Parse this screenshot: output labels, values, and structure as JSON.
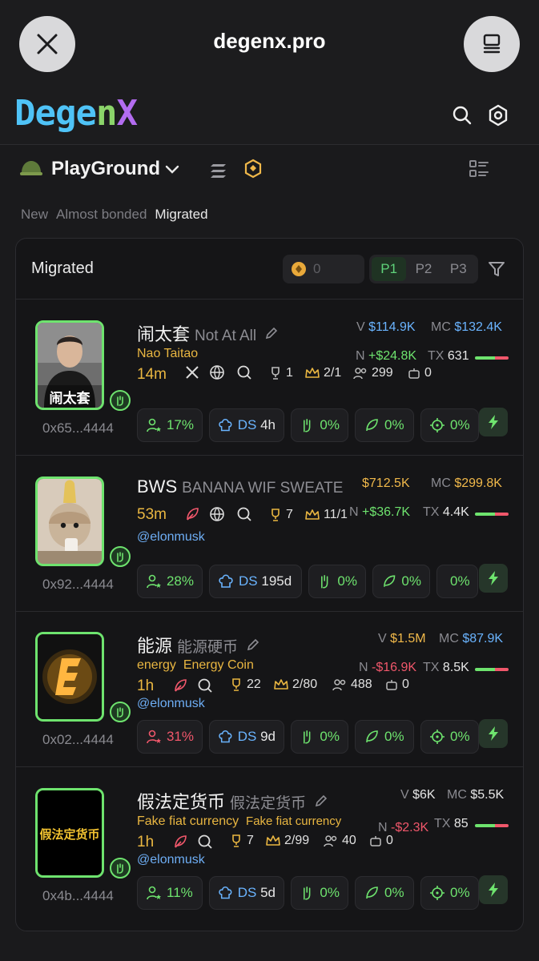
{
  "browser": {
    "title": "degenx.pro"
  },
  "app": {
    "logo": {
      "part1": "Dege",
      "part2": "n",
      "part3": "X"
    },
    "section_title": "PlayGround",
    "tabs": [
      "New",
      "Almost bonded",
      "Migrated"
    ],
    "active_tab": "Migrated"
  },
  "panel": {
    "title": "Migrated",
    "coin_count": "0",
    "page_tabs": [
      "P1",
      "P2",
      "P3"
    ],
    "active_page": "P1"
  },
  "tokens": [
    {
      "symbol": "闹太套",
      "name": "Not At All",
      "sub1": "Nao Taitao",
      "sub2": "",
      "age": "14m",
      "trophy": "1",
      "crown": "2/1",
      "holders": "299",
      "bots": "0",
      "handle": "",
      "address": "0x65...4444",
      "v": "$114.9K",
      "mc": "$132.4K",
      "n": "+$24.8K",
      "tx": "631",
      "chips": {
        "holders_pct": "17%",
        "ds": "4h",
        "c3": "0%",
        "c4": "0%",
        "c5": "0%"
      }
    },
    {
      "symbol": "BWS",
      "name": "BANANA WIF SWEATE",
      "sub1": "",
      "sub2": "",
      "age": "53m",
      "trophy": "7",
      "crown": "11/1",
      "holders": "",
      "bots": "",
      "handle": "@elonmusk",
      "address": "0x92...4444",
      "v": "$712.5K",
      "mc": "$299.8K",
      "n": "+$36.7K",
      "tx": "4.4K",
      "chips": {
        "holders_pct": "28%",
        "ds": "195d",
        "c3": "0%",
        "c4": "0%",
        "c5": "0%"
      }
    },
    {
      "symbol": "能源",
      "name": "能源硬币",
      "sub1": "energy",
      "sub2": "Energy Coin",
      "age": "1h",
      "trophy": "22",
      "crown": "2/80",
      "holders": "488",
      "bots": "0",
      "handle": "@elonmusk",
      "address": "0x02...4444",
      "v": "$1.5M",
      "mc": "$87.9K",
      "n": "-$16.9K",
      "tx": "8.5K",
      "chips": {
        "holders_pct": "31%",
        "ds": "9d",
        "c3": "0%",
        "c4": "0%",
        "c5": "0%"
      }
    },
    {
      "symbol": "假法定货币",
      "name": "假法定货币",
      "sub1": "Fake fiat currency",
      "sub2": "Fake fiat currency",
      "age": "1h",
      "trophy": "7",
      "crown": "2/99",
      "holders": "40",
      "bots": "0",
      "handle": "@elonmusk",
      "address": "0x4b...4444",
      "v": "$6K",
      "mc": "$5.5K",
      "n": "-$2.3K",
      "tx": "85",
      "chips": {
        "holders_pct": "11%",
        "ds": "5d",
        "c3": "0%",
        "c4": "0%",
        "c5": "0%"
      }
    }
  ],
  "labels": {
    "v": "V",
    "mc": "MC",
    "n": "N",
    "tx": "TX",
    "ds": "DS"
  },
  "thumb_text": {
    "t0": "闹太套",
    "t3": "假法定货币"
  }
}
